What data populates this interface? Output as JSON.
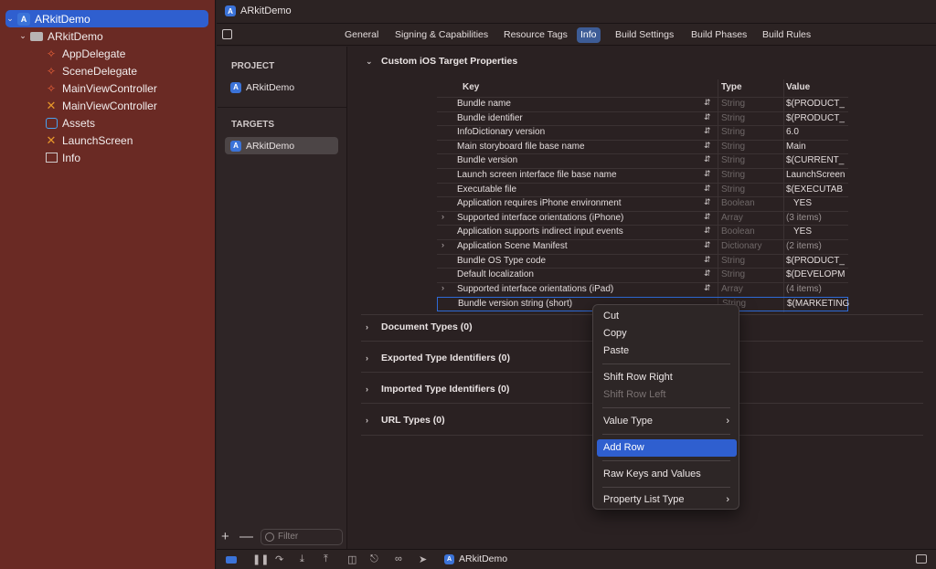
{
  "navigator": {
    "items": [
      {
        "label": "ARkitDemo",
        "icon": "app-icon"
      },
      {
        "label": "ARkitDemo",
        "icon": "folder-icon"
      },
      {
        "label": "AppDelegate",
        "icon": "swift-file-icon"
      },
      {
        "label": "SceneDelegate",
        "icon": "swift-file-icon"
      },
      {
        "label": "MainViewController",
        "icon": "swift-file-icon"
      },
      {
        "label": "MainViewController",
        "icon": "storyboard-icon"
      },
      {
        "label": "Assets",
        "icon": "asset-catalog-icon"
      },
      {
        "label": "LaunchScreen",
        "icon": "storyboard-icon"
      },
      {
        "label": "Info",
        "icon": "plist-icon"
      }
    ]
  },
  "editor": {
    "tab_title": "ARkitDemo",
    "tabs": [
      "General",
      "Signing & Capabilities",
      "Resource Tags",
      "Info",
      "Build Settings",
      "Build Phases",
      "Build Rules"
    ],
    "active_tab": "Info"
  },
  "targets_panel": {
    "project_header": "PROJECT",
    "project_item": "ARkitDemo",
    "targets_header": "TARGETS",
    "target_item": "ARkitDemo",
    "add_symbol": "+",
    "remove_symbol": "—",
    "filter_placeholder": "Filter"
  },
  "info": {
    "section_title": "Custom iOS Target Properties",
    "columns": {
      "key": "Key",
      "type": "Type",
      "value": "Value"
    },
    "rows": [
      {
        "key": "Bundle name",
        "type": "String",
        "value": "$(PRODUCT_"
      },
      {
        "key": "Bundle identifier",
        "type": "String",
        "value": "$(PRODUCT_"
      },
      {
        "key": "InfoDictionary version",
        "type": "String",
        "value": "6.0"
      },
      {
        "key": "Main storyboard file base name",
        "type": "String",
        "value": "Main"
      },
      {
        "key": "Bundle version",
        "type": "String",
        "value": "$(CURRENT_"
      },
      {
        "key": "Launch screen interface file base name",
        "type": "String",
        "value": "LaunchScreen"
      },
      {
        "key": "Executable file",
        "type": "String",
        "value": "$(EXECUTAB"
      },
      {
        "key": "Application requires iPhone environment",
        "type": "Boolean",
        "value": "YES"
      },
      {
        "key": "Supported interface orientations (iPhone)",
        "type": "Array",
        "value": "(3 items)"
      },
      {
        "key": "Application supports indirect input events",
        "type": "Boolean",
        "value": "YES"
      },
      {
        "key": "Application Scene Manifest",
        "type": "Dictionary",
        "value": "(2 items)"
      },
      {
        "key": "Bundle OS Type code",
        "type": "String",
        "value": "$(PRODUCT_"
      },
      {
        "key": "Default localization",
        "type": "String",
        "value": "$(DEVELOPM"
      },
      {
        "key": "Supported interface orientations (iPad)",
        "type": "Array",
        "value": "(4 items)"
      },
      {
        "key": "Bundle version string (short)",
        "type": "String",
        "value": "$(MARKETING"
      }
    ],
    "other_sections": [
      "Document Types (0)",
      "Exported Type Identifiers (0)",
      "Imported Type Identifiers (0)",
      "URL Types (0)"
    ]
  },
  "context_menu": {
    "items": [
      "Cut",
      "Copy",
      "Paste",
      "Shift Row Right",
      "Shift Row Left",
      "Value Type",
      "Add Row",
      "Raw Keys and Values",
      "Property List Type"
    ],
    "highlighted": "Add Row",
    "disabled": [
      "Shift Row Left"
    ]
  },
  "status_bar": {
    "scheme": "ARkitDemo"
  },
  "colors": {
    "navigator_bg": "#6a2a24",
    "selection": "#2f5fcf",
    "editor_bg": "#2a2122"
  }
}
